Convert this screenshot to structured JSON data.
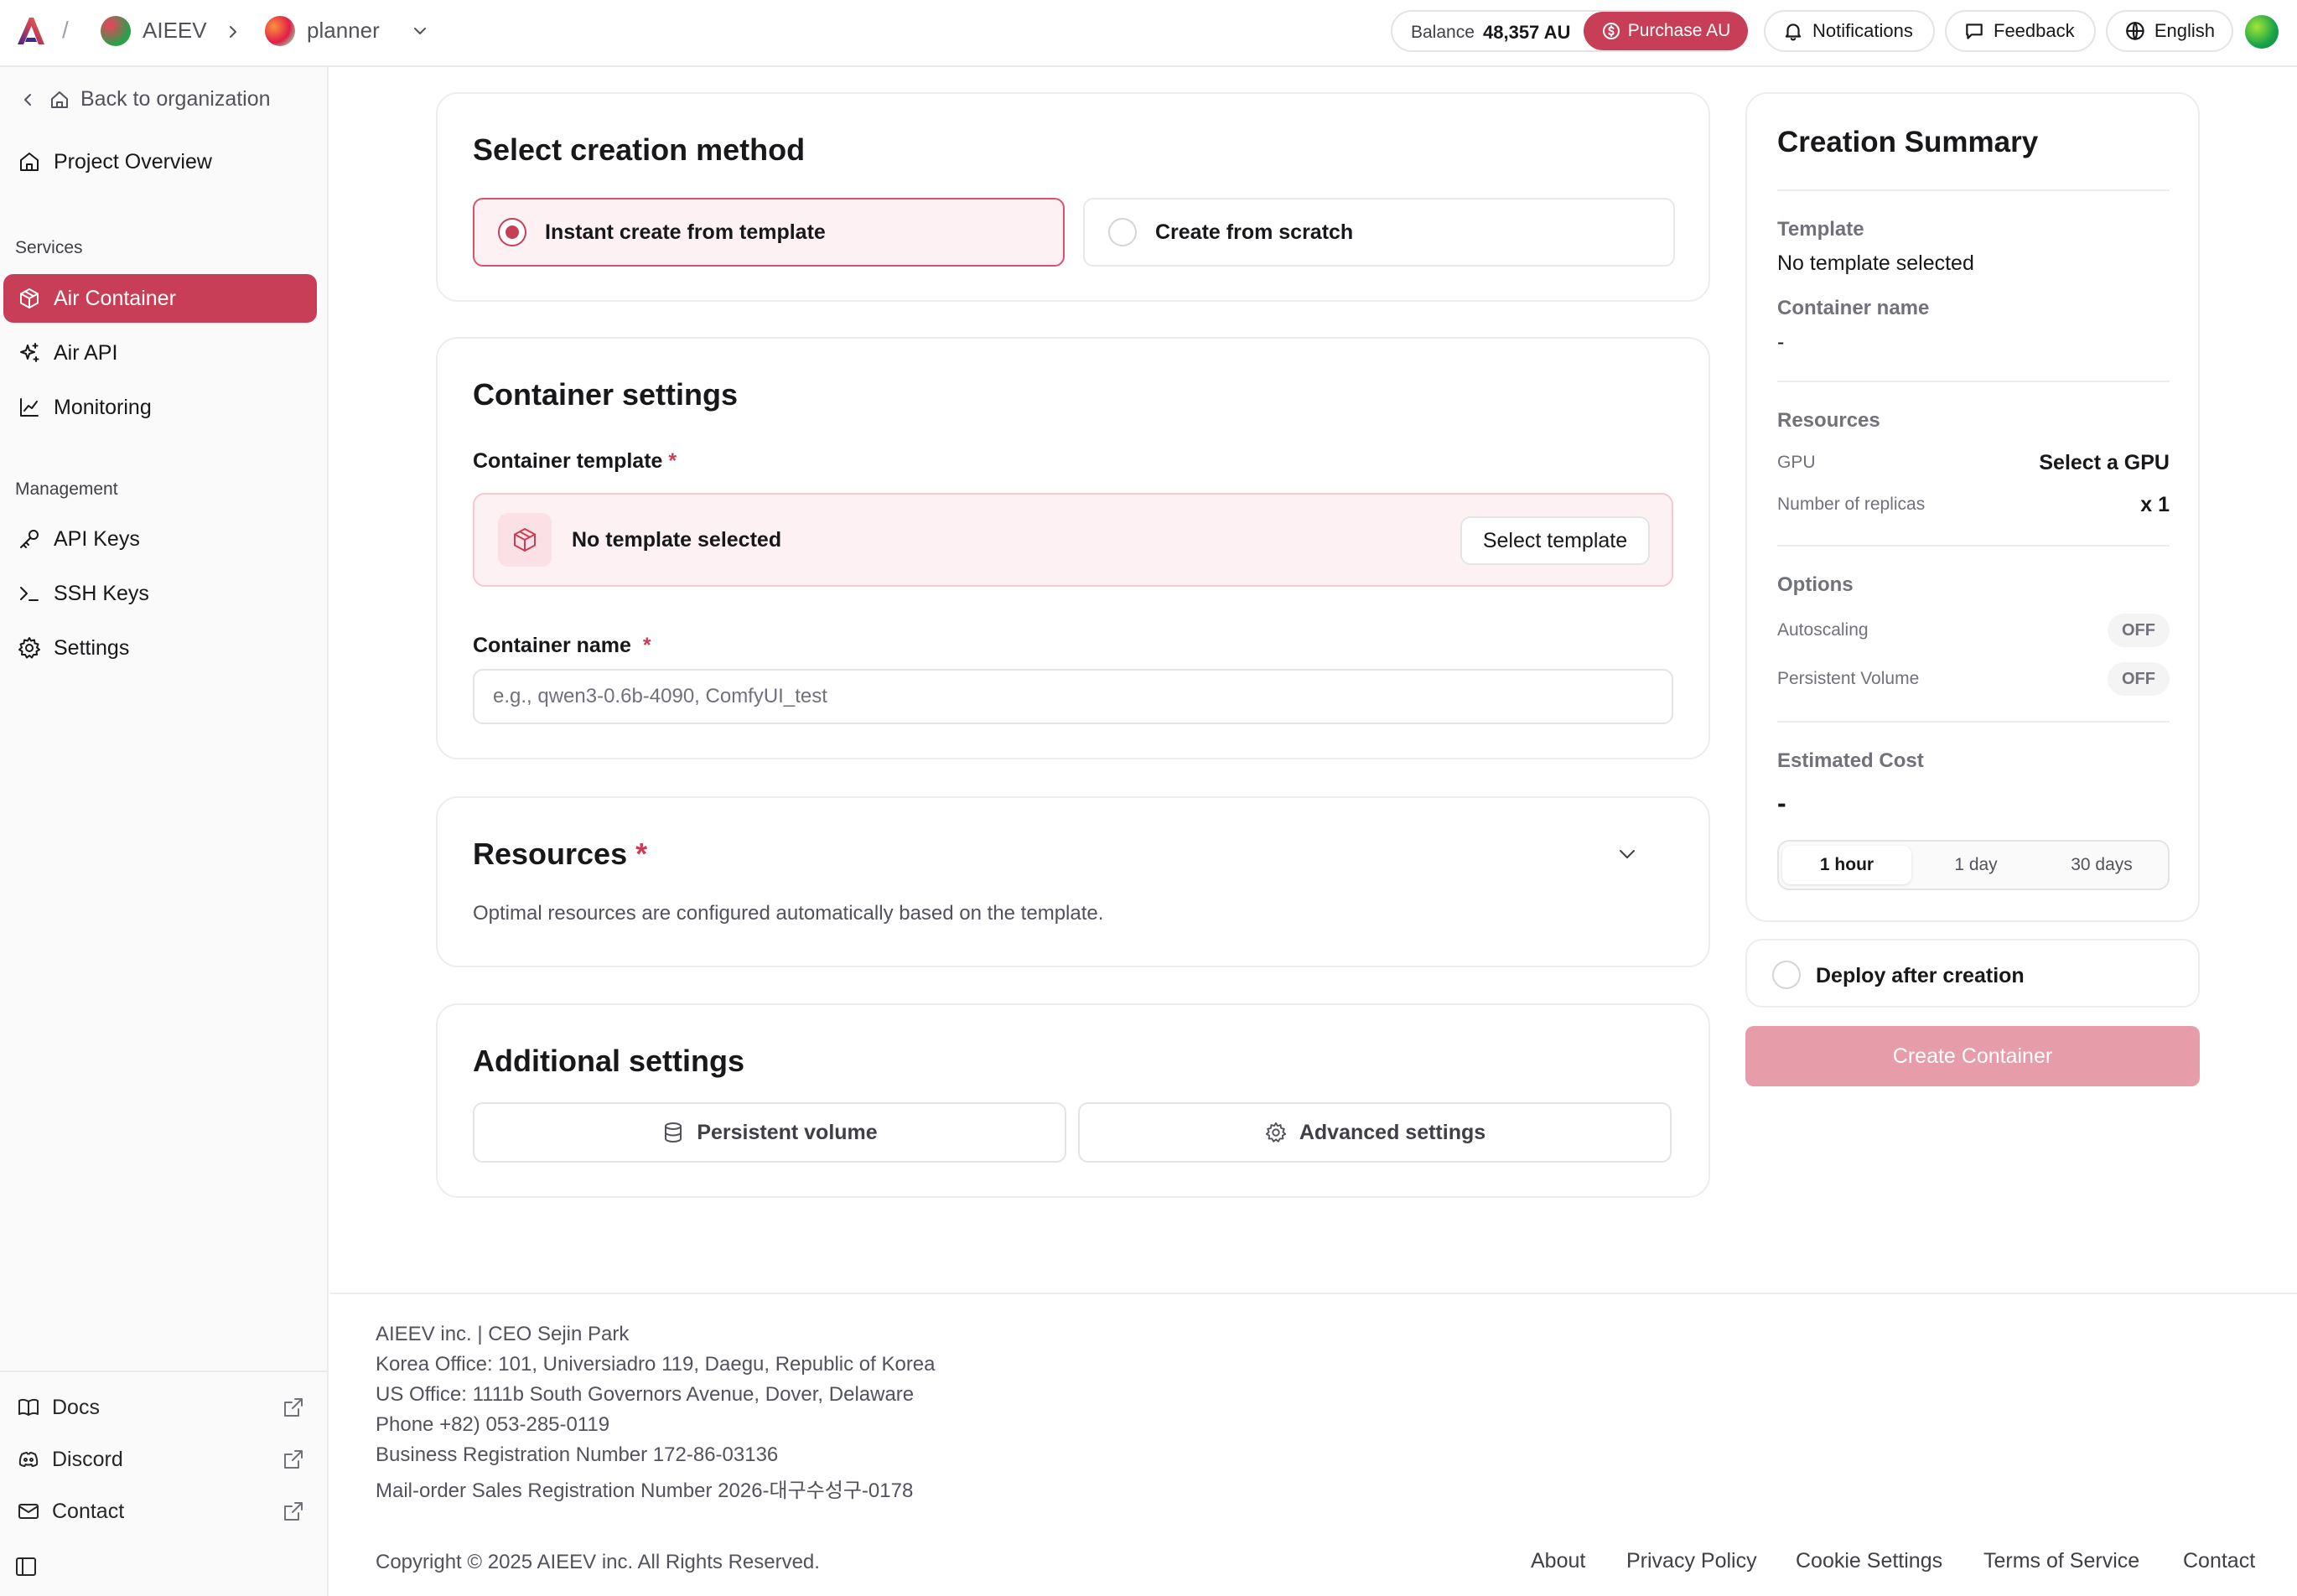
{
  "topbar": {
    "org_name": "AIEEV",
    "project_name": "planner",
    "balance_label": "Balance",
    "balance_value": "48,357 AU",
    "purchase_label": "Purchase AU",
    "notifications_label": "Notifications",
    "feedback_label": "Feedback",
    "language_label": "English"
  },
  "sidebar": {
    "back_label": "Back to organization",
    "overview_label": "Project Overview",
    "services_heading": "Services",
    "services": [
      {
        "label": "Air Container",
        "icon": "package-icon",
        "active": true
      },
      {
        "label": "Air API",
        "icon": "sparkle-icon",
        "active": false
      },
      {
        "label": "Monitoring",
        "icon": "chart-icon",
        "active": false
      }
    ],
    "management_heading": "Management",
    "management": [
      {
        "label": "API Keys",
        "icon": "key-icon"
      },
      {
        "label": "SSH Keys",
        "icon": "terminal-icon"
      },
      {
        "label": "Settings",
        "icon": "gear-icon"
      }
    ],
    "external": [
      {
        "label": "Docs",
        "icon": "book-icon"
      },
      {
        "label": "Discord",
        "icon": "discord-icon"
      },
      {
        "label": "Contact",
        "icon": "mail-icon"
      }
    ]
  },
  "creation_method": {
    "title": "Select creation method",
    "options": [
      {
        "label": "Instant create from template",
        "selected": true
      },
      {
        "label": "Create from scratch",
        "selected": false
      }
    ]
  },
  "container_settings": {
    "title": "Container settings",
    "template_label": "Container template",
    "required_mark": "*",
    "template_value": "No template selected",
    "select_template_label": "Select template",
    "name_label": "Container name",
    "name_placeholder": "e.g., qwen3-0.6b-4090, ComfyUI_test",
    "name_value": ""
  },
  "resources": {
    "title": "Resources",
    "required_mark": "*",
    "description": "Optimal resources are configured automatically based on the template."
  },
  "additional_settings": {
    "title": "Additional settings",
    "persistent_volume_label": "Persistent volume",
    "advanced_label": "Advanced settings"
  },
  "summary": {
    "title": "Creation Summary",
    "template_heading": "Template",
    "template_value": "No template selected",
    "container_name_heading": "Container name",
    "container_name_value": "-",
    "resources_heading": "Resources",
    "gpu_label": "GPU",
    "gpu_value": "Select a GPU",
    "replicas_label": "Number of replicas",
    "replicas_value": "x 1",
    "options_heading": "Options",
    "autoscaling_label": "Autoscaling",
    "autoscaling_value": "OFF",
    "persistent_volume_label": "Persistent Volume",
    "persistent_volume_value": "OFF",
    "cost_heading": "Estimated Cost",
    "cost_value": "-",
    "periods": [
      {
        "label": "1 hour",
        "active": true
      },
      {
        "label": "1 day",
        "active": false
      },
      {
        "label": "30 days",
        "active": false
      }
    ]
  },
  "deploy_label": "Deploy after creation",
  "create_button_label": "Create Container",
  "colors": {
    "accent": "#c93e57",
    "accent_light": "#fdf1f3",
    "disabled_button": "#e79caa"
  },
  "footer": {
    "lines": [
      "AIEEV inc. | CEO Sejin Park",
      "Korea Office: 101, Universiadro 119, Daegu, Republic of Korea",
      "US Office: 1111b South Governors Avenue, Dover, Delaware",
      "Phone +82) 053-285-0119",
      "Business Registration Number 172-86-03136",
      "Mail-order Sales Registration Number 2026-대구수성구-0178"
    ],
    "copyright": "Copyright © 2025 AIEEV inc. All Rights Reserved.",
    "links": [
      "About",
      "Privacy Policy",
      "Cookie Settings",
      "Terms of Service",
      "Contact"
    ]
  }
}
